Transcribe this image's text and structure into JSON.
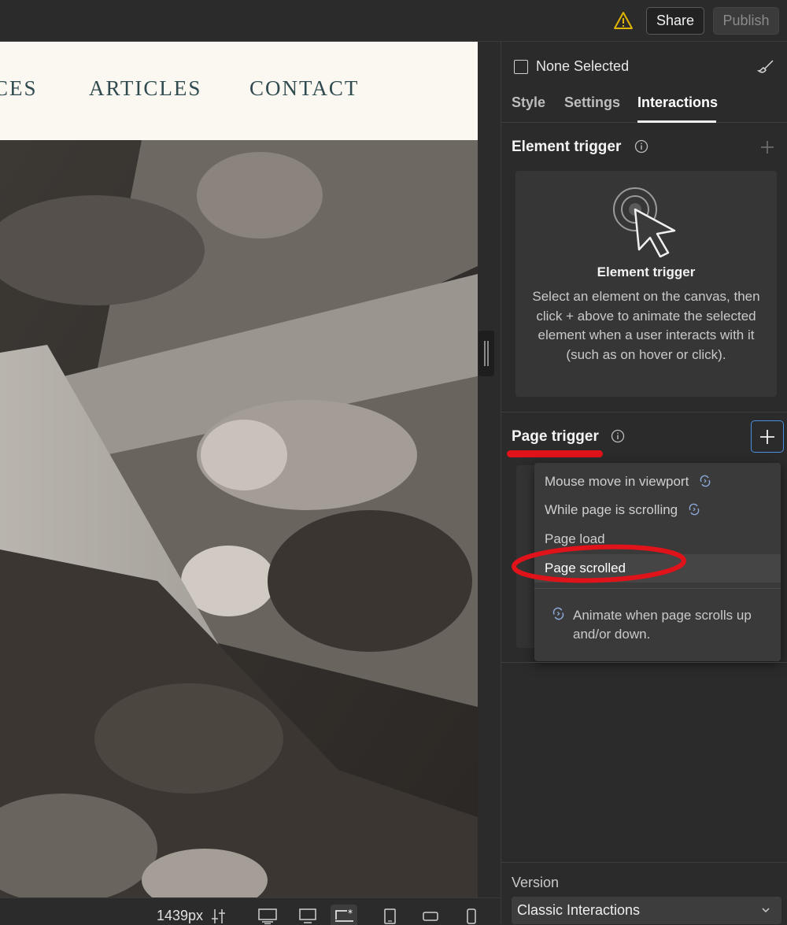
{
  "topbar": {
    "warning_icon": "warning-triangle-icon",
    "share_label": "Share",
    "publish_label": "Publish"
  },
  "site_nav": {
    "items": [
      "CES",
      "ARTICLES",
      "CONTACT"
    ]
  },
  "bottom_toolbar": {
    "width_readout": "1439px",
    "adjust_icon": "sliders-icon",
    "devices": [
      "desktop-large-icon",
      "desktop-icon",
      "desktop-base-icon",
      "tablet-icon",
      "mobile-landscape-icon",
      "mobile-portrait-icon"
    ]
  },
  "panel": {
    "selection_label": "None Selected",
    "tabs": [
      {
        "label": "Style",
        "active": false
      },
      {
        "label": "Settings",
        "active": false
      },
      {
        "label": "Interactions",
        "active": true
      }
    ],
    "element_trigger": {
      "title": "Element trigger",
      "card_title": "Element trigger",
      "card_desc": "Select an element on the canvas, then click + above to animate the selected element when a user interacts with it (such as on hover or click)."
    },
    "page_trigger": {
      "title": "Page trigger",
      "menu_items": [
        {
          "label": "Mouse move in viewport",
          "icon": "sync-icon"
        },
        {
          "label": "While page is scrolling",
          "icon": "sync-icon"
        },
        {
          "label": "Page load",
          "icon": ""
        },
        {
          "label": "Page scrolled",
          "icon": ""
        }
      ],
      "highlighted_item": "Page scrolled",
      "hint": "Animate when page scrolls up and/or down."
    },
    "version": {
      "label": "Version",
      "selected": "Classic Interactions"
    }
  },
  "colors": {
    "accent_blue": "#4a90e2",
    "annotation_red": "#e0121a",
    "panel_bg": "#2b2b2b",
    "nav_text": "#2f4b4f"
  }
}
